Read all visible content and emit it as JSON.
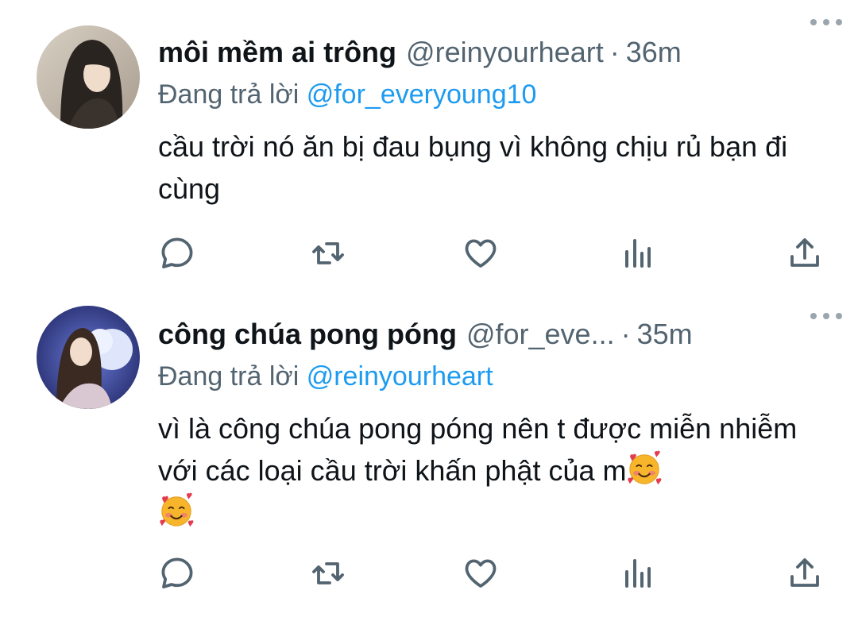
{
  "tweets": [
    {
      "name": "môi mềm ai trông",
      "handle": "@reinyourheart",
      "separator": "·",
      "time": "36m",
      "replying_prefix": "Đang trả lời",
      "replying_to": "@for_everyoung10",
      "text": "cầu trời nó ăn bị đau bụng vì không chịu rủ bạn đi cùng",
      "icons": [
        "reply-icon",
        "retweet-icon",
        "like-icon",
        "views-icon",
        "share-icon",
        "more-icon"
      ]
    },
    {
      "name": "công chúa pong póng",
      "handle": "@for_eve...",
      "separator": "·",
      "time": "35m",
      "replying_prefix": "Đang trả lời",
      "replying_to": "@reinyourheart",
      "text": "vì là công chúa pong póng nên t được miễn nhiễm với các loại cầu trời khấn phật của m",
      "emoji": "smiling-face-with-hearts",
      "icons": [
        "reply-icon",
        "retweet-icon",
        "like-icon",
        "views-icon",
        "share-icon",
        "more-icon"
      ]
    }
  ],
  "colors": {
    "text": "#0f1419",
    "secondary": "#536471",
    "link": "#1d9bf0",
    "icon": "#536471"
  }
}
